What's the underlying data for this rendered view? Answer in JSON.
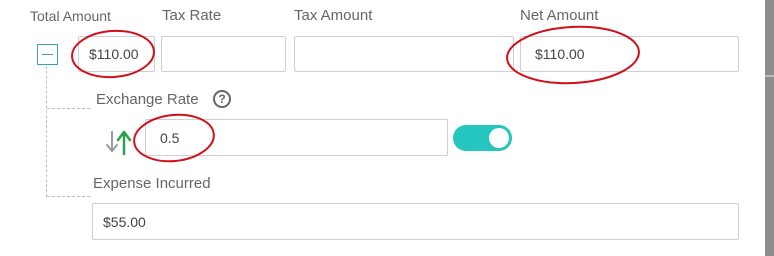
{
  "labels": {
    "total_amount": "Total Amount",
    "tax_rate": "Tax Rate",
    "tax_amount": "Tax Amount",
    "net_amount": "Net Amount",
    "exchange_rate": "Exchange Rate",
    "expense_incurred": "Expense Incurred"
  },
  "fields": {
    "total_amount": "$110.00",
    "tax_rate": "",
    "tax_amount": "",
    "net_amount": "$110.00",
    "exchange_rate": "0.5",
    "expense_incurred": "$55.00"
  },
  "icons": {
    "collapse": "minus-square-icon",
    "help": "question-circle-icon",
    "help_glyph": "?",
    "swap": "swap-arrows-icon"
  },
  "toggle": {
    "state": "on"
  },
  "colors": {
    "toggle_on": "#25c5c0",
    "collapse_accent": "#3aa0c8",
    "swap_down": "#9a9a9a",
    "swap_up": "#27a24a",
    "annotation": "#d0101a"
  }
}
